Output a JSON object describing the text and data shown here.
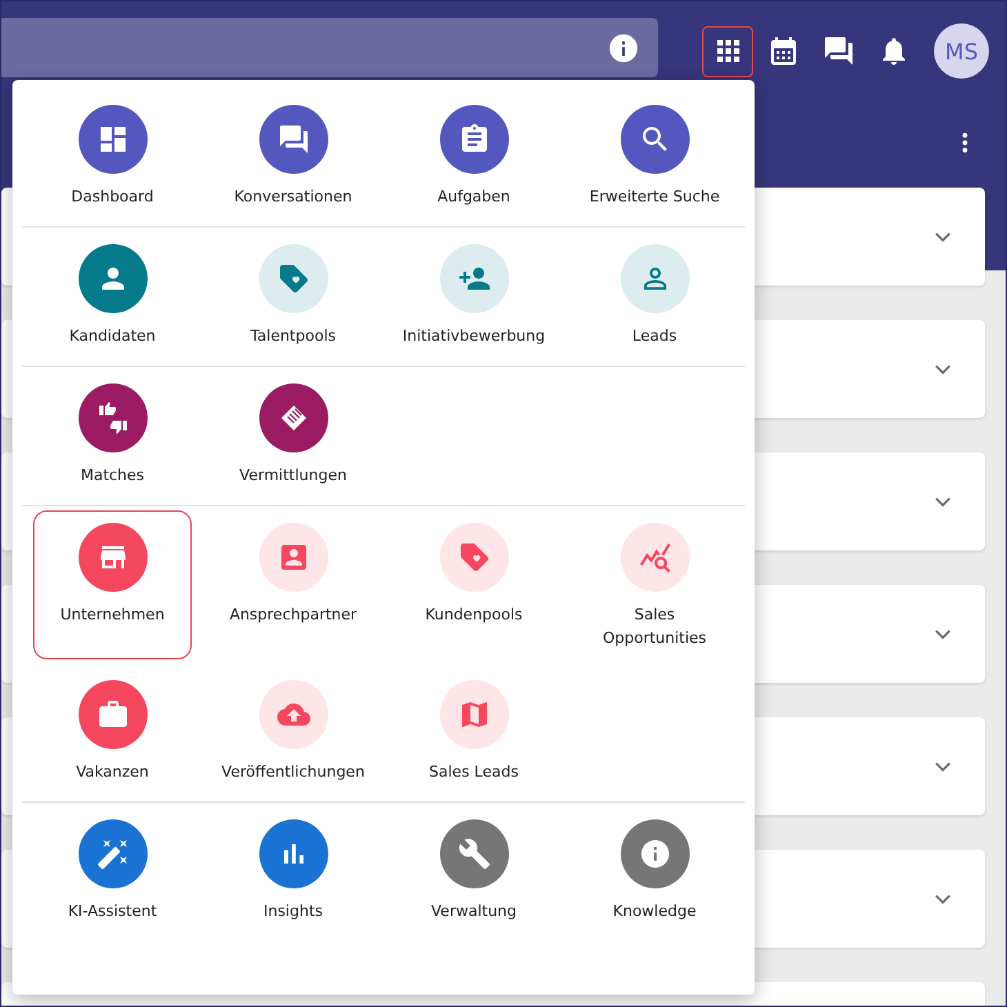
{
  "top_bar": {
    "toolbar": [
      {
        "selected": true
      },
      {
        "selected": false
      },
      {
        "selected": false
      },
      {
        "selected": false
      }
    ],
    "avatar": "MS"
  },
  "menu": {
    "sections": [
      {
        "items": [
          {
            "label": "Dashboard",
            "color": "#5457be",
            "filled": true,
            "selected": false
          },
          {
            "label": "Konversationen",
            "color": "#5457be",
            "filled": true,
            "selected": false
          },
          {
            "label": "Aufgaben",
            "color": "#5457be",
            "filled": true,
            "selected": false
          },
          {
            "label": "Erweiterte Suche",
            "color": "#5457be",
            "filled": true,
            "selected": false
          }
        ]
      },
      {
        "items": [
          {
            "label": "Kandidaten",
            "color": "#047a8a",
            "filled": true,
            "selected": false
          },
          {
            "label": "Talentpools",
            "color": "#047a8a",
            "filled": false,
            "selected": false
          },
          {
            "label": "Initiativbewerbung",
            "color": "#047a8a",
            "filled": false,
            "selected": false
          },
          {
            "label": "Leads",
            "color": "#047a8a",
            "filled": false,
            "selected": false
          }
        ]
      },
      {
        "items": [
          {
            "label": "Matches",
            "color": "#9b1c62",
            "filled": true,
            "selected": false
          },
          {
            "label": "Vermittlungen",
            "color": "#9b1c62",
            "filled": true,
            "selected": false
          }
        ]
      },
      {
        "items": [
          {
            "label": "Unternehmen",
            "color": "#f5475e",
            "filled": true,
            "selected": true
          },
          {
            "label": "Ansprechpartner",
            "color": "#f5475e",
            "filled": false,
            "selected": false
          },
          {
            "label": "Kundenpools",
            "color": "#f5475e",
            "filled": false,
            "selected": false
          },
          {
            "label": "Sales Opportunities",
            "color": "#f5475e",
            "filled": false,
            "selected": false
          },
          {
            "label": "Vakanzen",
            "color": "#f5475e",
            "filled": true,
            "selected": false
          },
          {
            "label": "Veröffentlichungen",
            "color": "#f5475e",
            "filled": false,
            "selected": false
          },
          {
            "label": "Sales Leads",
            "color": "#f5475e",
            "filled": false,
            "selected": false
          }
        ]
      },
      {
        "items": [
          {
            "label": "KI-Assistent",
            "color": "#1a73d3",
            "filled": true,
            "selected": false
          },
          {
            "label": "Insights",
            "color": "#1a73d3",
            "filled": true,
            "selected": false
          },
          {
            "label": "Verwaltung",
            "color": "#767676",
            "filled": true,
            "selected": false
          },
          {
            "label": "Knowledge",
            "color": "#767676",
            "filled": true,
            "selected": false
          }
        ]
      }
    ]
  },
  "cards": [
    {
      "expanded": false
    },
    {
      "expanded": false
    },
    {
      "expanded": false
    },
    {
      "expanded": false
    },
    {
      "expanded": false
    },
    {
      "expanded": false
    }
  ]
}
